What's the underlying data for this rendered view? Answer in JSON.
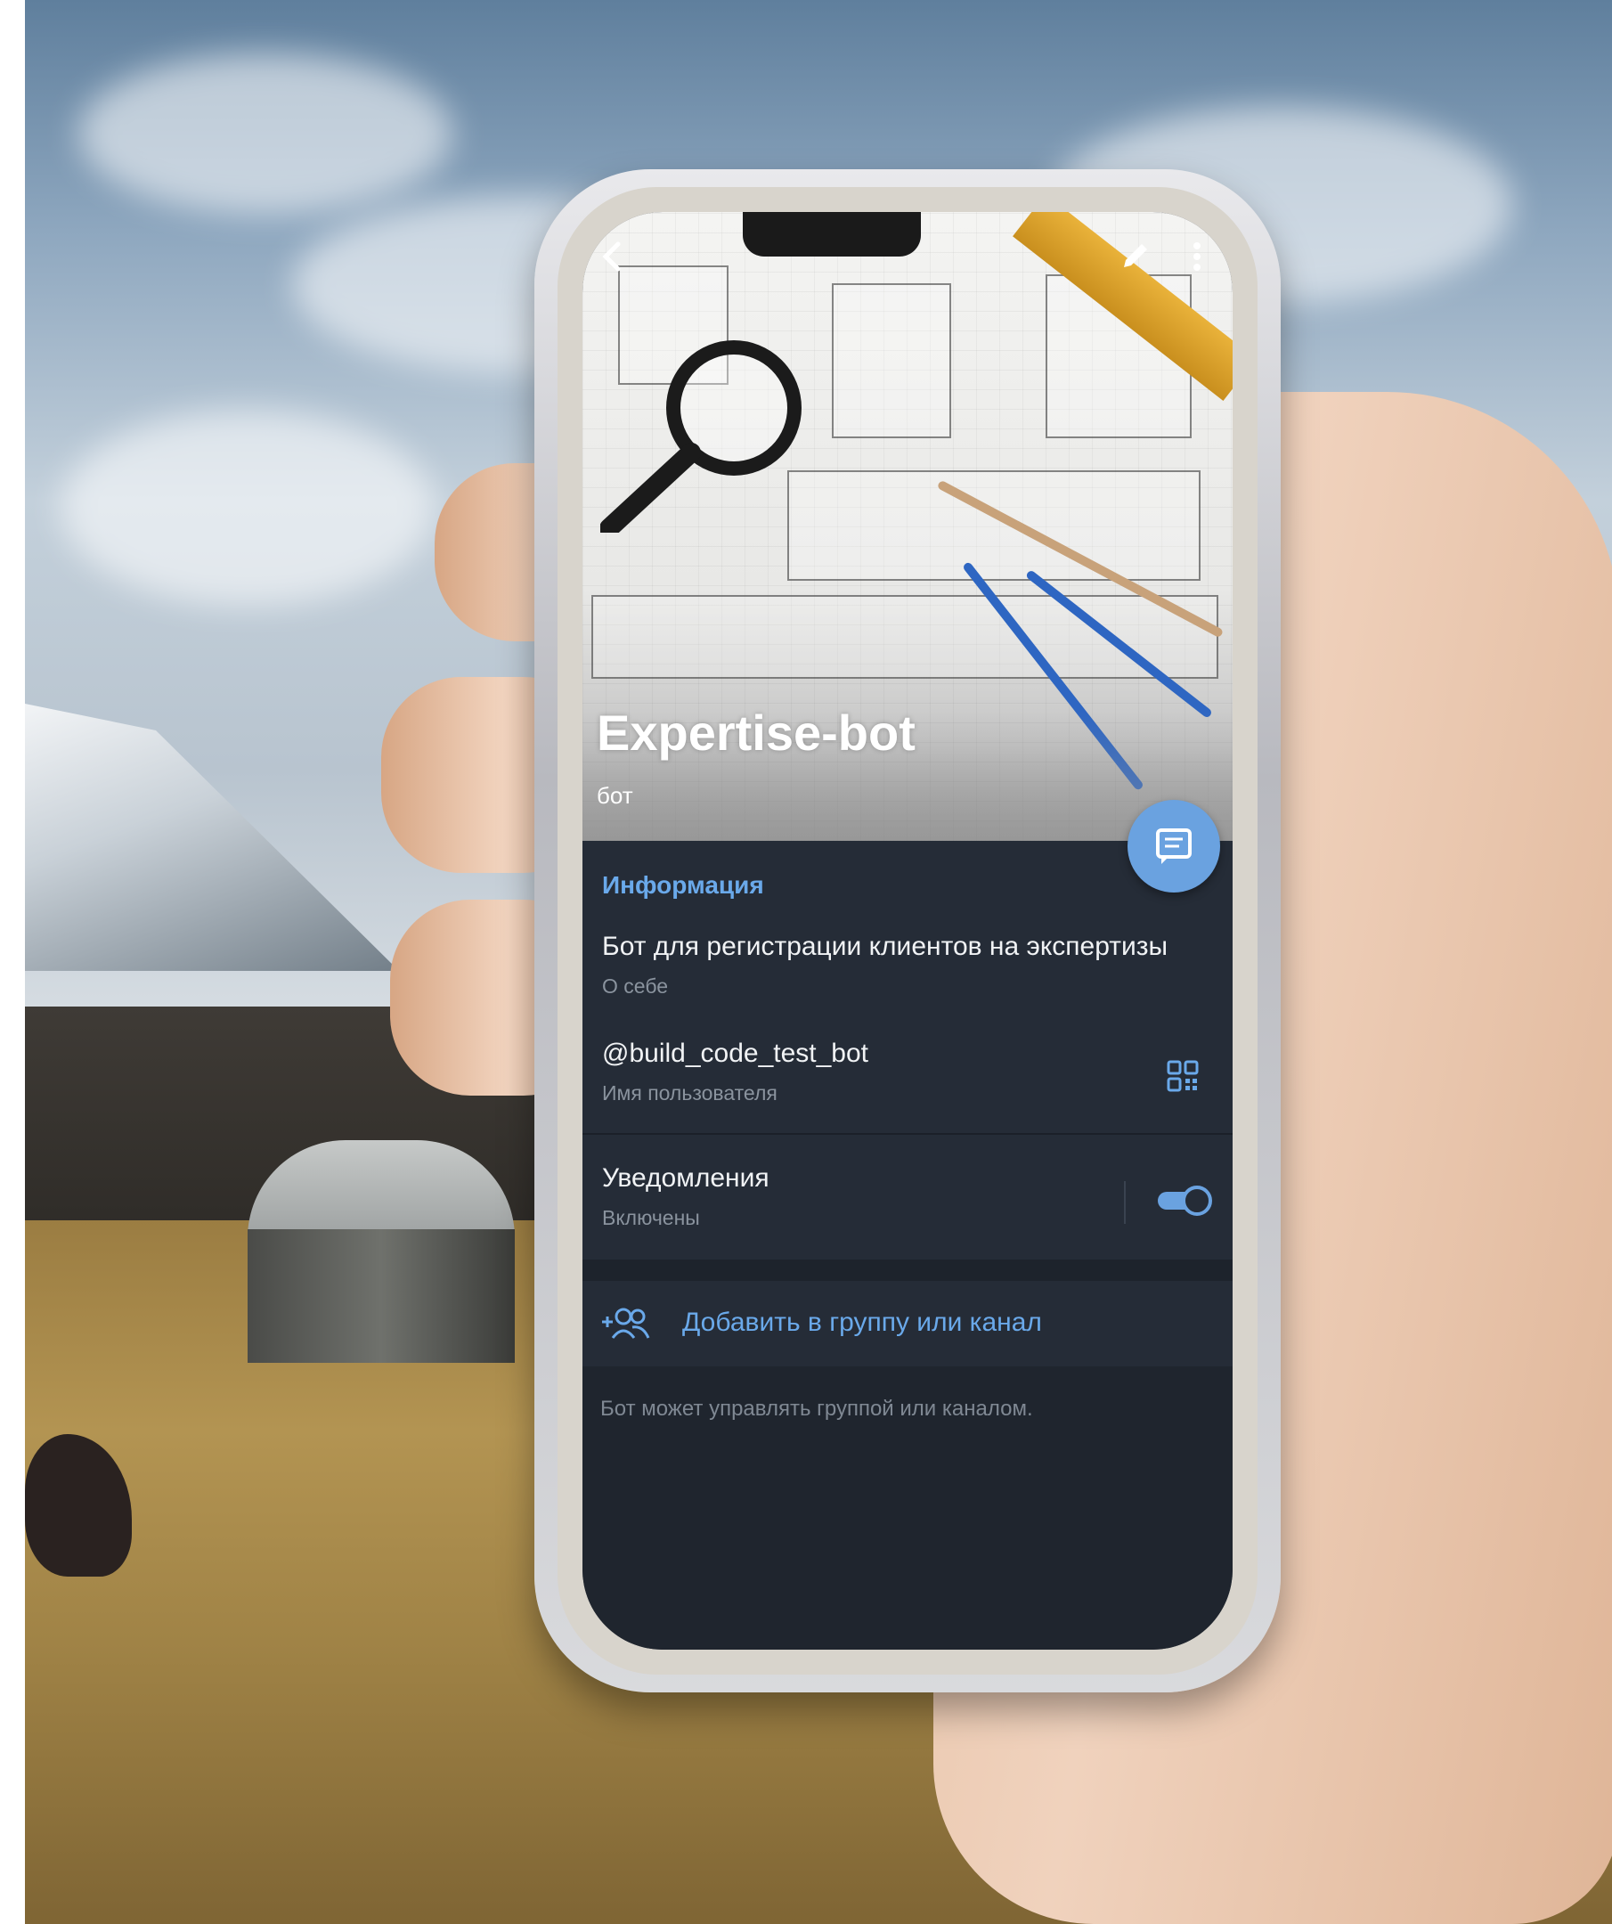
{
  "profile": {
    "name": "Expertise-bot",
    "type": "бот"
  },
  "info": {
    "section_title": "Информация",
    "about": {
      "value": "Бот для регистрации клиентов на экспертизы",
      "label": "О себе"
    },
    "username": {
      "value": "@build_code_test_bot",
      "label": "Имя пользователя"
    },
    "notifications": {
      "title": "Уведомления",
      "status": "Включены",
      "enabled": true
    }
  },
  "actions": {
    "add_to_group": "Добавить в группу или канал"
  },
  "footer_note": "Бот может управлять группой или каналом.",
  "icons": {
    "back": "back-arrow-icon",
    "edit": "pencil-icon",
    "more": "more-vertical-icon",
    "message": "message-icon",
    "qr": "qr-code-icon",
    "add_users": "add-users-icon"
  },
  "colors": {
    "accent": "#6aa9ea",
    "fab": "#6aa2e0",
    "panel": "#252c37",
    "text": "#f1f3f5",
    "subtext": "#8a939e"
  }
}
